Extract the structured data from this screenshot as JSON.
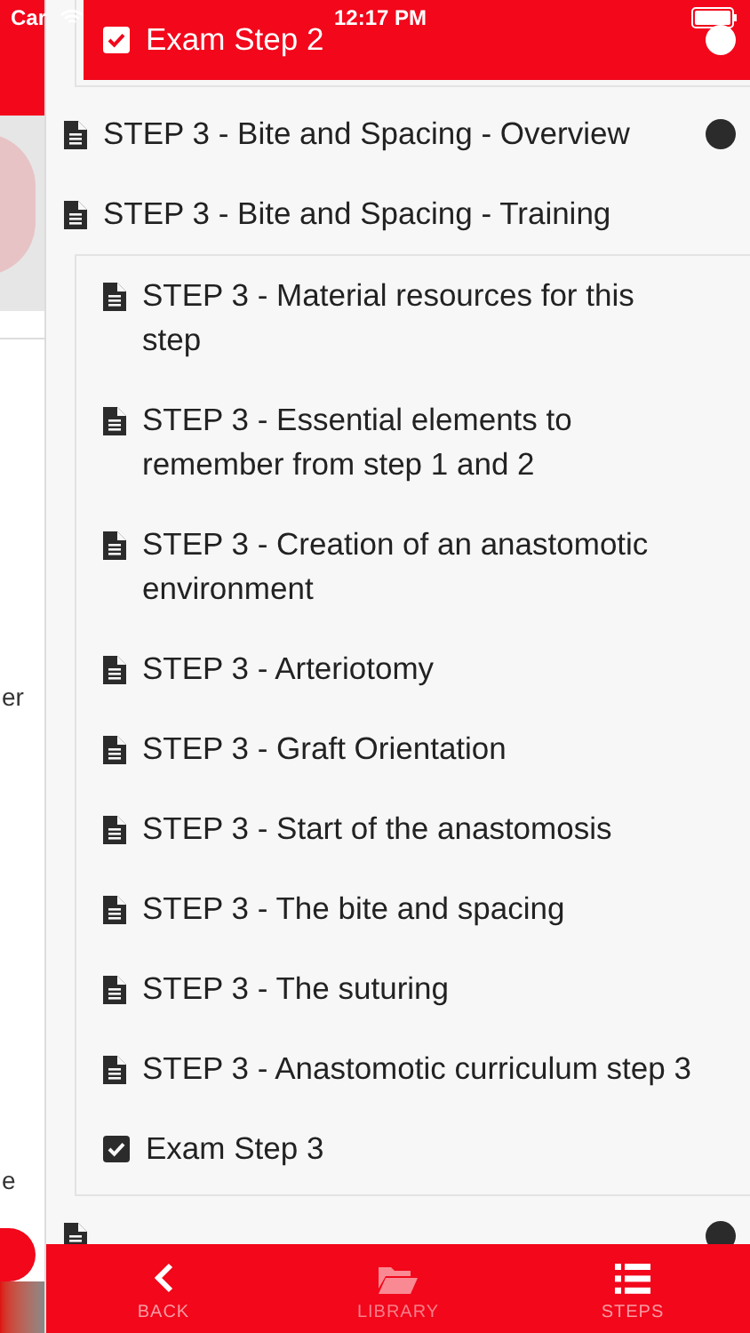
{
  "status_bar": {
    "carrier": "Car",
    "time": "12:17 PM"
  },
  "background_page": {
    "texts": [
      "er",
      "e"
    ]
  },
  "outline": [
    {
      "kind": "continued",
      "children": [
        {
          "kind": "exam",
          "label": "Exam Step 2",
          "selected": true,
          "marked": true
        }
      ]
    },
    {
      "kind": "document",
      "label": "STEP 3 - Bite and Spacing - Overview",
      "selected": false,
      "marked": true
    },
    {
      "kind": "document",
      "label": "STEP 3 - Bite and Spacing - Training",
      "selected": false,
      "marked": false,
      "children": [
        {
          "kind": "document",
          "label": "STEP 3 - Material resources for this step",
          "selected": false,
          "marked": false
        },
        {
          "kind": "document",
          "label": "STEP 3 - Essential elements to remember from step 1 and 2",
          "selected": false,
          "marked": false
        },
        {
          "kind": "document",
          "label": "STEP 3 - Creation of an anastomotic environment",
          "selected": false,
          "marked": false
        },
        {
          "kind": "document",
          "label": "STEP 3 - Arteriotomy",
          "selected": false,
          "marked": false
        },
        {
          "kind": "document",
          "label": "STEP 3 - Graft Orientation",
          "selected": false,
          "marked": false
        },
        {
          "kind": "document",
          "label": "STEP 3 - Start of the anastomosis",
          "selected": false,
          "marked": false
        },
        {
          "kind": "document",
          "label": "STEP 3 - The bite and spacing",
          "selected": false,
          "marked": false
        },
        {
          "kind": "document",
          "label": "STEP 3 - The suturing",
          "selected": false,
          "marked": false
        },
        {
          "kind": "document",
          "label": "STEP 3 - Anastomotic curriculum step 3",
          "selected": false,
          "marked": false
        },
        {
          "kind": "exam",
          "label": "Exam Step 3",
          "selected": false,
          "marked": false
        }
      ]
    },
    {
      "kind": "document",
      "selected": false,
      "marked": true
    }
  ],
  "tab_bar": [
    {
      "kind": "back",
      "label": "BACK",
      "disabled": false
    },
    {
      "kind": "library",
      "label": "LIBRARY",
      "disabled": true
    },
    {
      "kind": "steps",
      "label": "STEPS",
      "disabled": false
    }
  ]
}
